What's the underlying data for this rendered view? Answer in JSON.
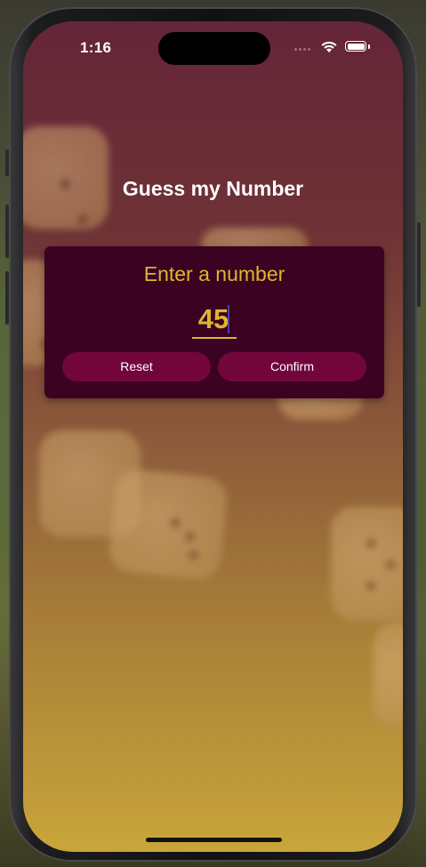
{
  "status_bar": {
    "time": "1:16",
    "icons": [
      "cellular-signal-icon",
      "wifi-icon",
      "battery-icon"
    ]
  },
  "screen": {
    "title": "Guess my Number",
    "gradient_colors": [
      "#652538",
      "#c9a53a"
    ]
  },
  "card": {
    "label": "Enter a number",
    "input_value": "45",
    "reset_label": "Reset",
    "confirm_label": "Confirm"
  },
  "colors": {
    "card_background": "#3b0221",
    "accent": "#ddb52f",
    "button_background": "#72063c",
    "title_text": "#ffffff"
  }
}
